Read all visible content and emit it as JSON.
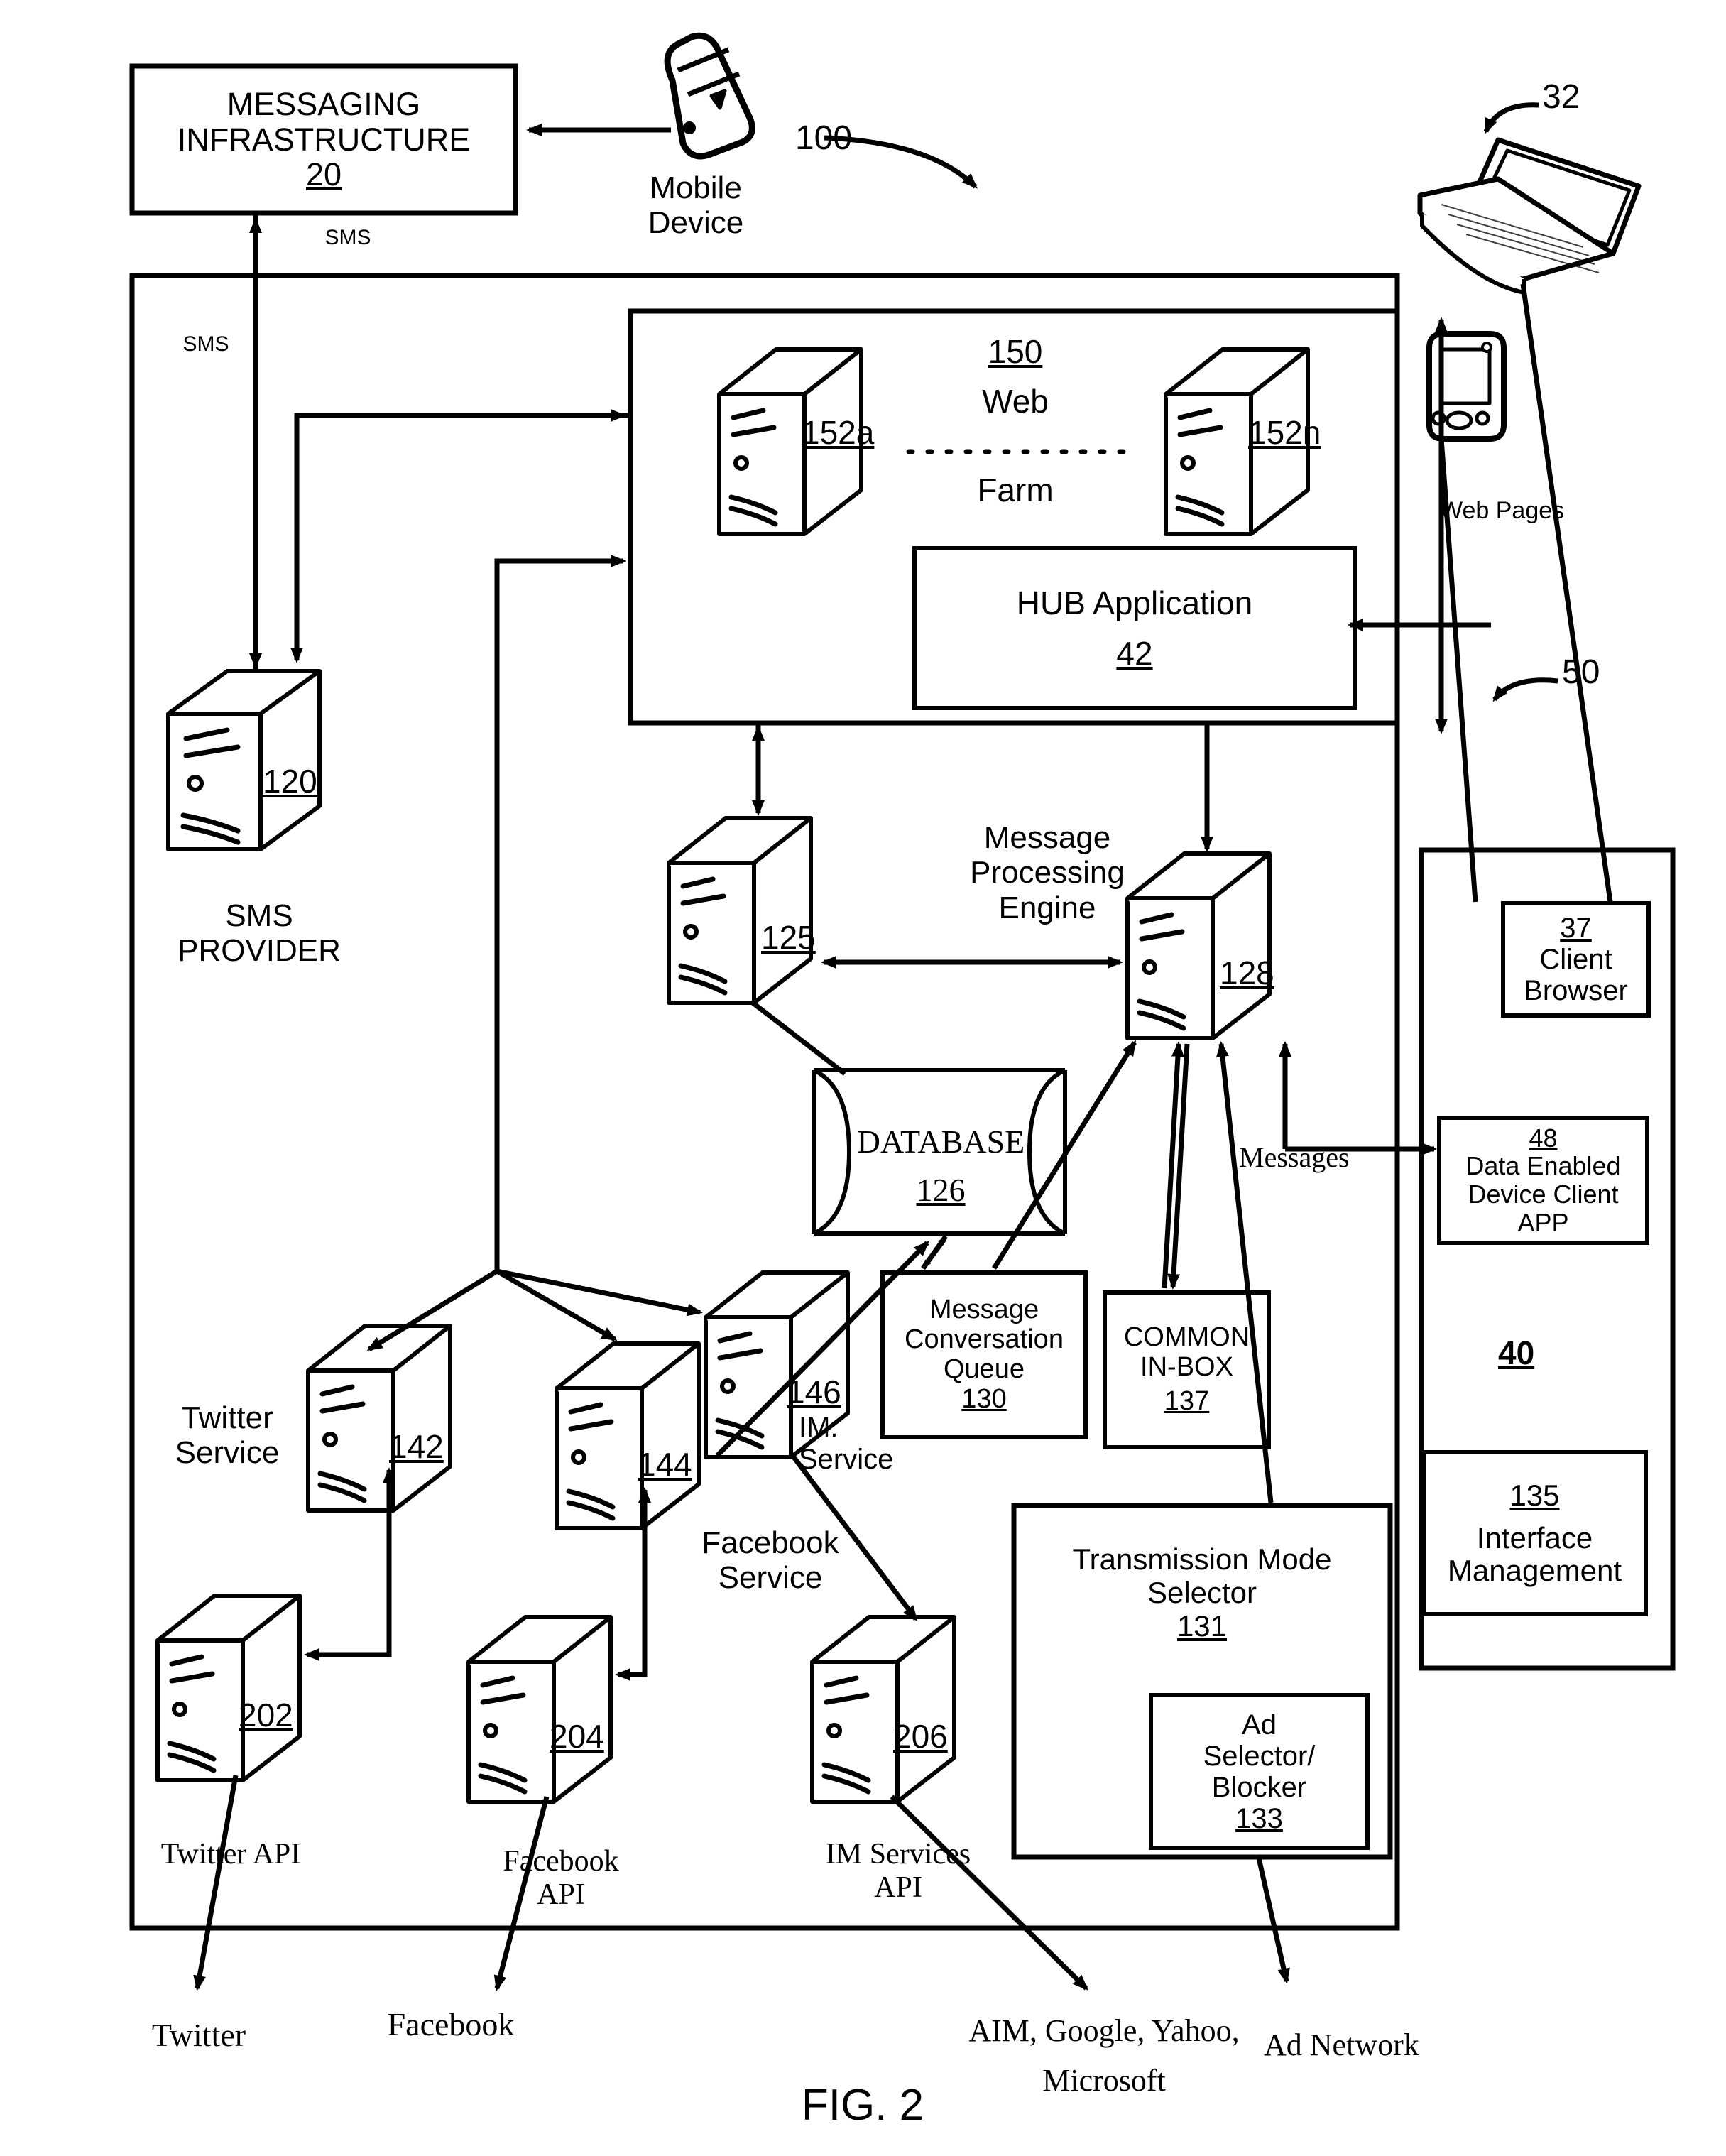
{
  "figure": {
    "caption": "FIG. 2",
    "system_ref": "100"
  },
  "top": {
    "messaging_infrastructure": {
      "line1": "MESSAGING",
      "line2": "INFRASTRUCTURE",
      "ref": "20"
    },
    "mobile_device": {
      "line1": "Mobile",
      "line2": "Device"
    },
    "sms_label_top": "SMS",
    "sms_label_left": "SMS"
  },
  "web_farm": {
    "ref": "150",
    "title_line1": "Web",
    "title_line2": "Farm",
    "server_a": "152a",
    "server_n": "152n",
    "hub": {
      "label": "HUB Application",
      "ref": "42"
    }
  },
  "sms_provider": {
    "ref": "120",
    "line1": "SMS",
    "line2": "PROVIDER"
  },
  "middle": {
    "server_125": "125",
    "mpe": {
      "line1": "Message",
      "line2": "Processing",
      "line3": "Engine",
      "ref": "128"
    },
    "database": {
      "label": "DATABASE",
      "ref": "126"
    },
    "messages_label": "Messages"
  },
  "services": {
    "twitter": {
      "line1": "Twitter",
      "line2": "Service",
      "ref": "142"
    },
    "facebook": {
      "line1": "Facebook",
      "line2": "Service",
      "ref": "144"
    },
    "im": {
      "line1": "IM.",
      "line2": "Service",
      "ref": "146"
    }
  },
  "apis": {
    "twitter": {
      "label": "Twitter API",
      "ref": "202"
    },
    "facebook": {
      "line1": "Facebook",
      "line2": "API",
      "ref": "204"
    },
    "im": {
      "line1": "IM Services",
      "line2": "API",
      "ref": "206"
    }
  },
  "queues": {
    "conversation_queue": {
      "line1": "Message",
      "line2": "Conversation",
      "line3": "Queue",
      "ref": "130"
    },
    "common_inbox": {
      "line1": "COMMON",
      "line2": "IN-BOX",
      "ref": "137"
    }
  },
  "transmission": {
    "line1": "Transmission Mode",
    "line2": "Selector",
    "ref": "131",
    "ad": {
      "line1": "Ad",
      "line2": "Selector/",
      "line3": "Blocker",
      "ref": "133"
    }
  },
  "client_side": {
    "laptop_ref": "32",
    "pda_ref": "50",
    "web_pages_label": "Web Pages",
    "client_browser": {
      "ref": "37",
      "line1": "Client",
      "line2": "Browser"
    },
    "device_client_app": {
      "ref": "48",
      "line1": "Data Enabled",
      "line2": "Device Client",
      "line3": "APP"
    },
    "link_ref": "40",
    "interface_mgmt": {
      "ref": "135",
      "line1": "Interface",
      "line2": "Management"
    }
  },
  "external": {
    "twitter": "Twitter",
    "facebook": "Facebook",
    "im_networks_line1": "AIM, Google, Yahoo,",
    "im_networks_line2": "Microsoft",
    "ad_network": "Ad Network"
  },
  "colors": {
    "ink": "#000000",
    "paper": "#ffffff"
  }
}
